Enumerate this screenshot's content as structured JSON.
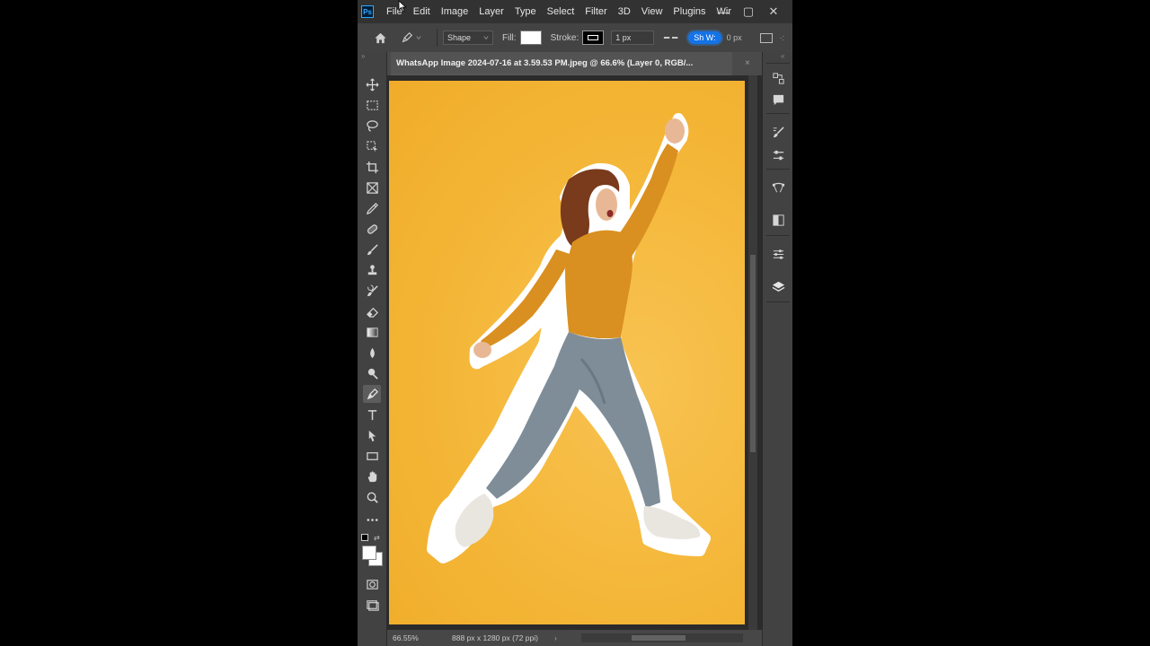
{
  "menu": {
    "items": [
      "File",
      "Edit",
      "Image",
      "Layer",
      "Type",
      "Select",
      "Filter",
      "3D",
      "View",
      "Plugins",
      "Wir"
    ],
    "logo": "Ps",
    "window_controls": {
      "minimize": "—",
      "restore": "▢",
      "close": "✕"
    }
  },
  "options": {
    "mode": "Shape",
    "fill_label": "Fill:",
    "stroke_label": "Stroke:",
    "stroke_width": "1 px",
    "shape_w_chip": "Sh W:",
    "shape_w_value": "0 px",
    "more": "·:",
    "fill_color": "#ffffff",
    "stroke_color": "#000000"
  },
  "document": {
    "tab_title": "WhatsApp Image 2024-07-16 at 3.59.53 PM.jpeg @ 66.6% (Layer 0, RGB/...",
    "tab_close": "×",
    "canvas_color": "#f4b637"
  },
  "status": {
    "zoom": "66.55%",
    "doc_size": "888 px x 1280 px (72 ppi)",
    "arrow": "›"
  },
  "tools": [
    "move-tool",
    "marquee-tool",
    "lasso-tool",
    "object-select-tool",
    "crop-tool",
    "frame-tool",
    "eyedropper-tool",
    "healing-brush-tool",
    "brush-tool",
    "clone-stamp-tool",
    "history-brush-tool",
    "eraser-tool",
    "gradient-tool",
    "blur-tool",
    "dodge-tool",
    "pen-tool",
    "type-tool",
    "path-selection-tool",
    "rectangle-tool",
    "hand-tool",
    "zoom-tool",
    "edit-toolbar"
  ],
  "active_tool": "pen-tool",
  "panels": [
    "history-panel",
    "comments-panel",
    "brushes-panel",
    "adjustments-panel",
    "paths-panel",
    "swatches-panel",
    "properties-panel",
    "layers-panel"
  ]
}
